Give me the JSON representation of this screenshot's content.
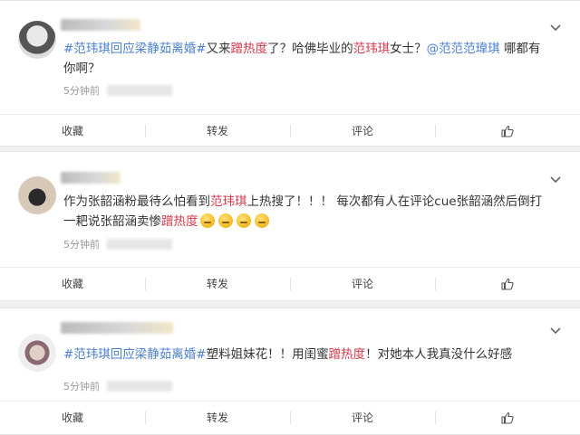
{
  "posts": [
    {
      "segments": [
        {
          "t": "#范玮琪回应梁静茹离婚#",
          "c": "topic"
        },
        {
          "t": "又来",
          "c": ""
        },
        {
          "t": "蹭热度",
          "c": "red"
        },
        {
          "t": "了？哈佛毕业的",
          "c": ""
        },
        {
          "t": "范玮琪",
          "c": "red"
        },
        {
          "t": "女士？",
          "c": ""
        },
        {
          "t": "@范范范瑋琪",
          "c": "topic"
        },
        {
          "t": " 哪都有你啊？",
          "c": ""
        }
      ],
      "time": "5分钟前",
      "actions": {
        "collect": "收藏",
        "repost": "转发",
        "comment": "评论"
      }
    },
    {
      "segments": [
        {
          "t": "作为张韶涵粉最待么怕看到",
          "c": ""
        },
        {
          "t": "范玮琪",
          "c": "red"
        },
        {
          "t": "上热搜了！！！ 每次都有人在评论cue张韶涵然后倒打一耙说张韶涵卖惨",
          "c": ""
        },
        {
          "t": "蹭热度",
          "c": "red"
        }
      ],
      "emoji_count": 4,
      "time": "5分钟前",
      "actions": {
        "collect": "收藏",
        "repost": "转发",
        "comment": "评论"
      }
    },
    {
      "segments": [
        {
          "t": "#范玮琪回应梁静茹离婚#",
          "c": "topic"
        },
        {
          "t": "塑料姐妹花！！用闺蜜",
          "c": ""
        },
        {
          "t": "蹭热度",
          "c": "red"
        },
        {
          "t": "！对她本人我真没什么好感",
          "c": ""
        }
      ],
      "time": "5分钟前",
      "actions": {
        "collect": "收藏",
        "repost": "转发",
        "comment": "评论"
      }
    }
  ],
  "icons": {
    "menu": "chevron-down-icon",
    "like": "thumbs-up-icon",
    "emoji": "grimace-emoji"
  },
  "colors": {
    "topic": "#4a7fd2",
    "highlight": "#d8384a",
    "meta": "#999999"
  }
}
